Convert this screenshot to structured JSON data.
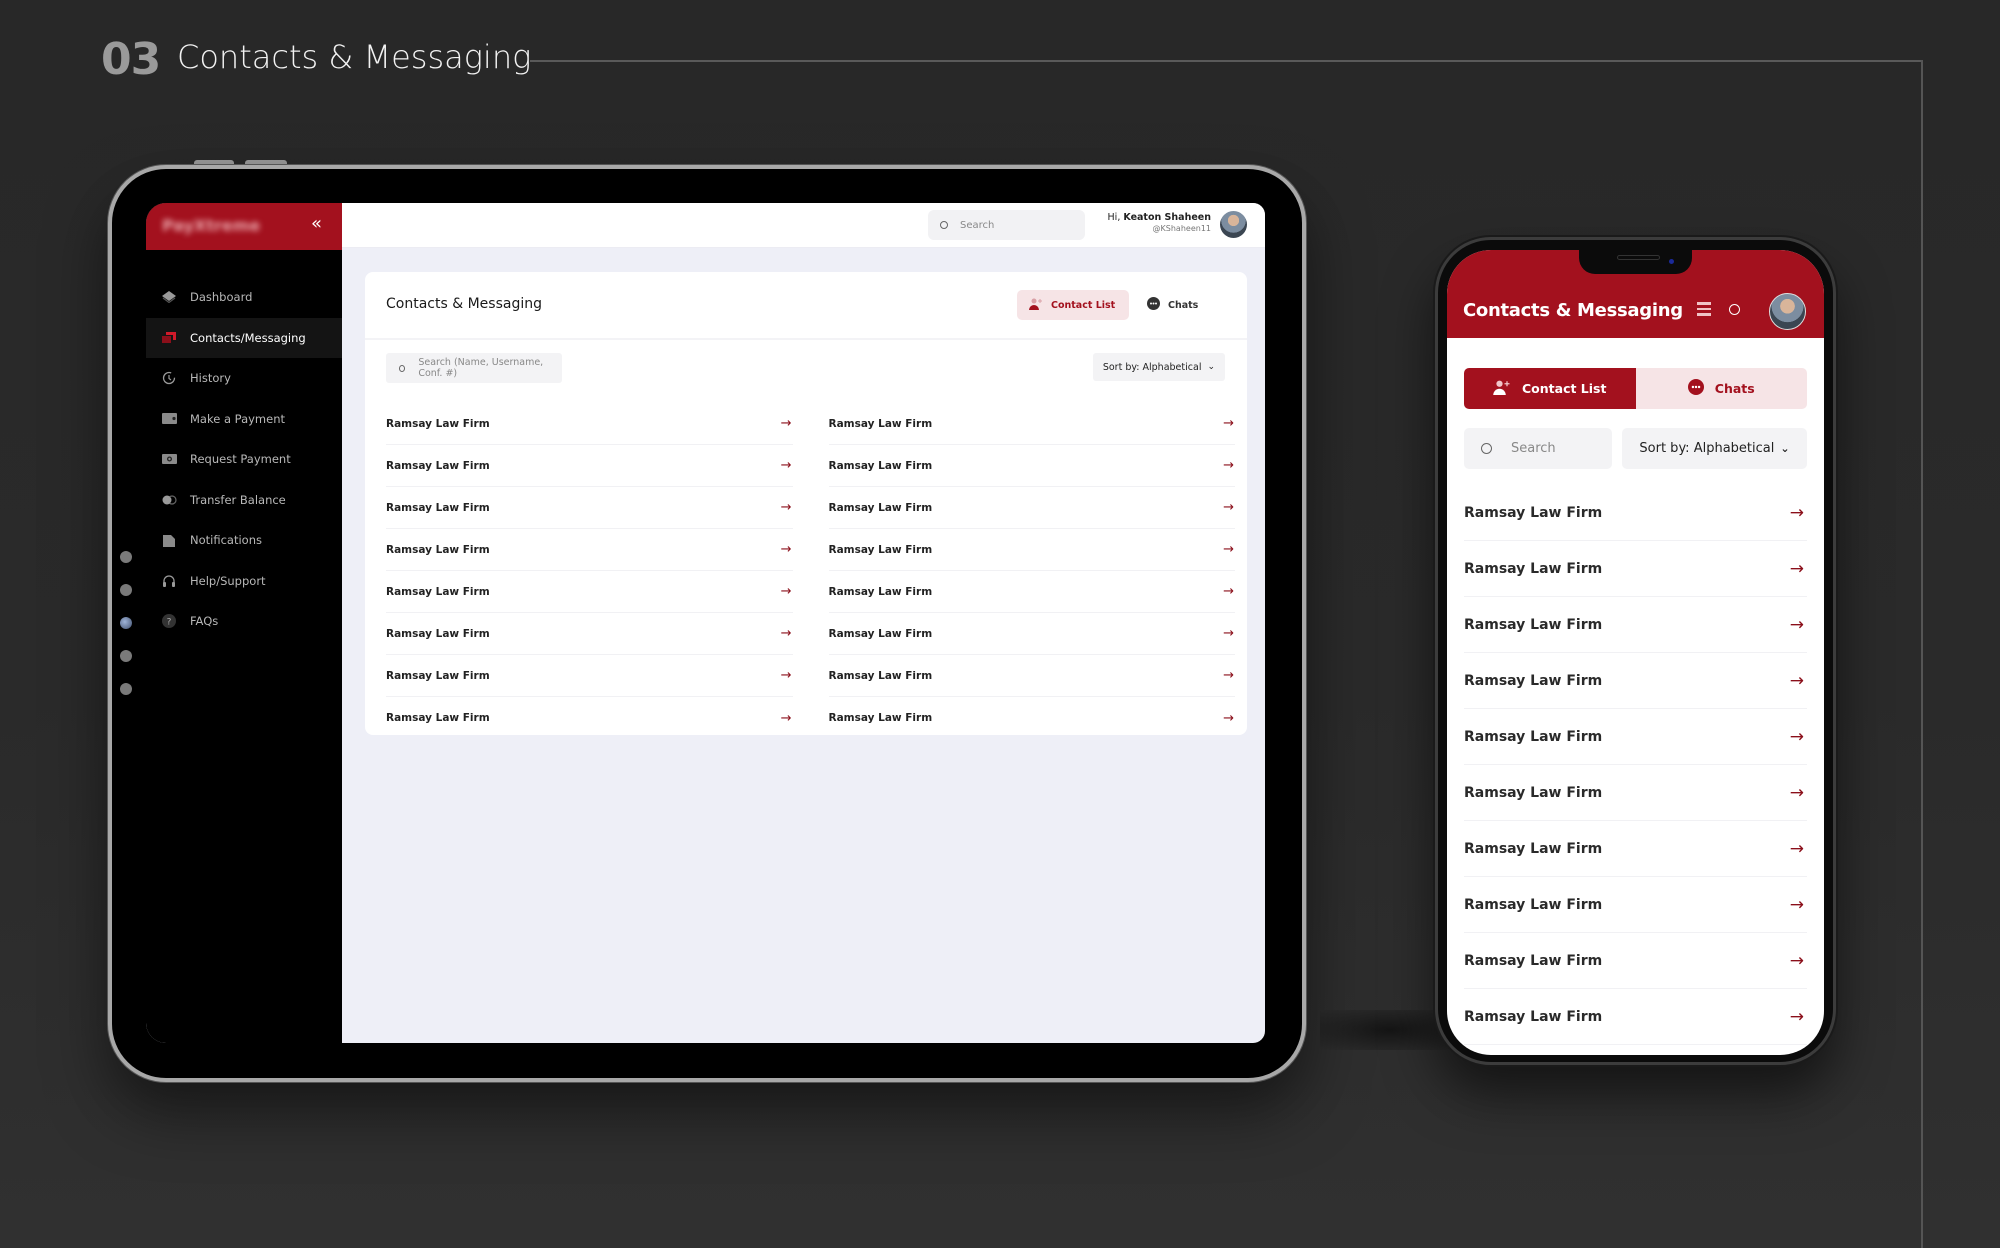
{
  "section": {
    "number": "03",
    "title": "Contacts & Messaging"
  },
  "tablet": {
    "sidebar": {
      "logo": "PayXtreme",
      "collapse_icon": "«",
      "items": [
        {
          "label": "Dashboard",
          "icon": "layers-icon",
          "active": false
        },
        {
          "label": "Contacts/Messaging",
          "icon": "contacts-icon",
          "active": true
        },
        {
          "label": "History",
          "icon": "history-icon",
          "active": false
        },
        {
          "label": "Make a Payment",
          "icon": "wallet-icon",
          "active": false
        },
        {
          "label": "Request Payment",
          "icon": "cash-icon",
          "active": false
        },
        {
          "label": "Transfer Balance",
          "icon": "toggle-icon",
          "active": false
        },
        {
          "label": "Notifications",
          "icon": "bell-doc-icon",
          "active": false
        },
        {
          "label": "Help/Support",
          "icon": "headphones-icon",
          "active": false
        },
        {
          "label": "FAQs",
          "icon": "question-icon",
          "active": false
        }
      ]
    },
    "topbar": {
      "search_placeholder": "Search",
      "greeting": "Hi,",
      "user_name": "Keaton Shaheen",
      "user_handle": "@KShaheen11"
    },
    "card": {
      "title": "Contacts & Messaging",
      "tabs": [
        {
          "label": "Contact List",
          "active": true
        },
        {
          "label": "Chats",
          "active": false
        }
      ],
      "search_placeholder": "Search (Name, Username, Conf. #)",
      "sort_label": "Sort by: Alphabetical",
      "left_column": [
        "Ramsay Law Firm",
        "Ramsay Law Firm",
        "Ramsay Law Firm",
        "Ramsay Law Firm",
        "Ramsay Law Firm",
        "Ramsay Law Firm",
        "Ramsay Law Firm",
        "Ramsay Law Firm"
      ],
      "right_column": [
        "Ramsay Law Firm",
        "Ramsay Law Firm",
        "Ramsay Law Firm",
        "Ramsay Law Firm",
        "Ramsay Law Firm",
        "Ramsay Law Firm",
        "Ramsay Law Firm",
        "Ramsay Law Firm"
      ]
    }
  },
  "phone": {
    "title": "Contacts & Messaging",
    "tabs": [
      {
        "label": "Contact List",
        "active": true
      },
      {
        "label": "Chats",
        "active": false
      }
    ],
    "search_placeholder": "Search",
    "sort_label": "Sort by: Alphabetical",
    "contacts": [
      "Ramsay Law Firm",
      "Ramsay Law Firm",
      "Ramsay Law Firm",
      "Ramsay Law Firm",
      "Ramsay Law Firm",
      "Ramsay Law Firm",
      "Ramsay Law Firm",
      "Ramsay Law Firm",
      "Ramsay Law Firm",
      "Ramsay Law Firm"
    ]
  },
  "colors": {
    "brand": "#a3111e",
    "brand_light": "#f6e4e6",
    "content_bg": "#eeeff7",
    "sidebar_bg": "#000000"
  }
}
